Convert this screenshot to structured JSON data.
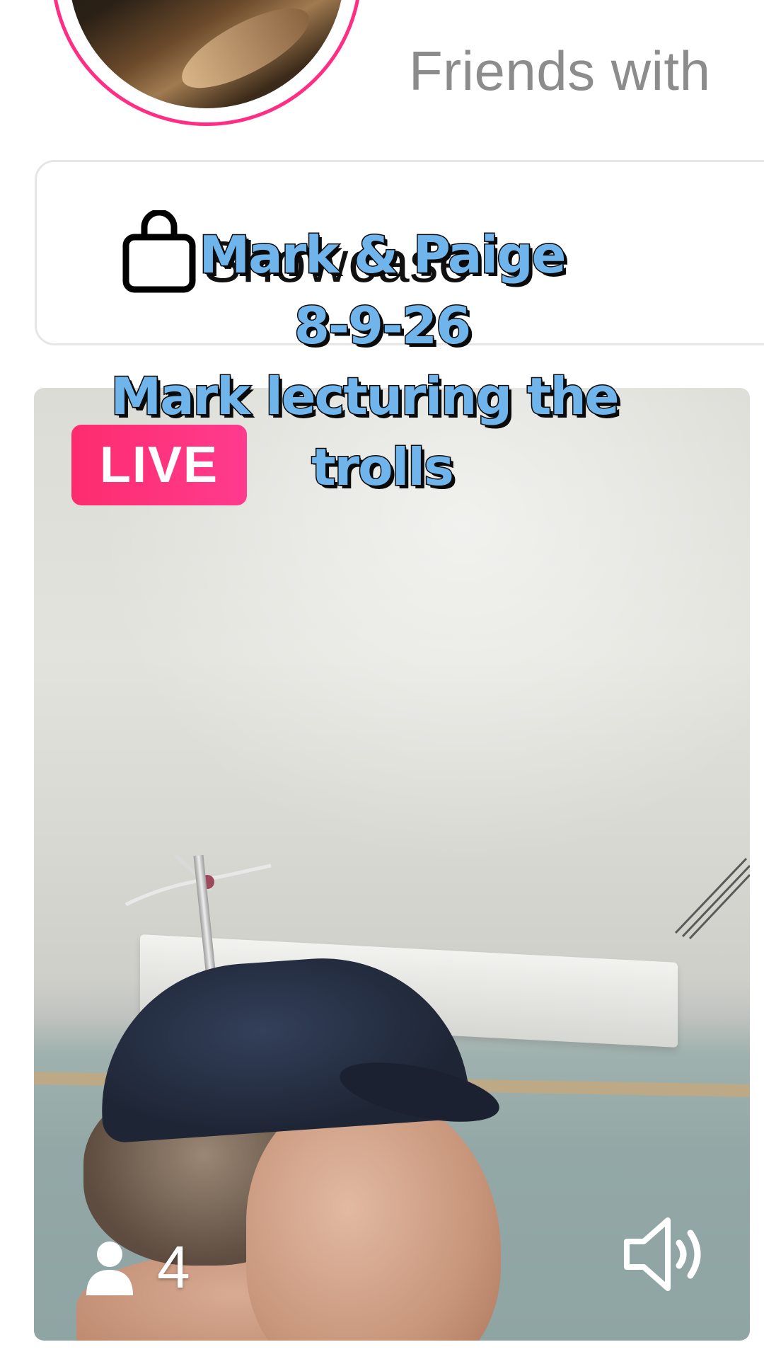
{
  "profile": {
    "friends_text": "Friends with"
  },
  "showcase": {
    "label": "Showcase"
  },
  "live": {
    "badge_label": "LIVE",
    "viewer_count": "4"
  },
  "caption": {
    "line1": "Mark & Paige",
    "line2": "8-9-26",
    "line3": "Mark lecturing the",
    "line4": "trolls"
  },
  "colors": {
    "live_badge": "#fe2c6e",
    "avatar_ring": "#ff2d83",
    "caption_fill": "#6fb5ec"
  },
  "icons": {
    "bag": "shopping-bag-icon",
    "viewer": "person-icon",
    "speaker": "speaker-volume-icon"
  }
}
